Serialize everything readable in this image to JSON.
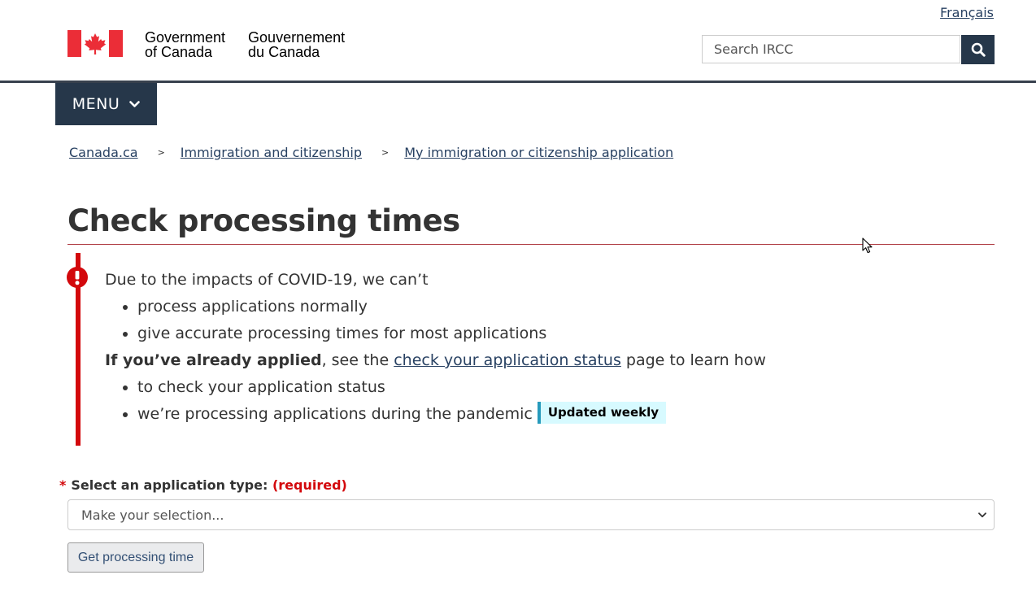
{
  "header": {
    "language_link": "Français",
    "signature_en": [
      "Government",
      "of Canada"
    ],
    "signature_fr": [
      "Gouvernement",
      "du Canada"
    ],
    "search_placeholder": "Search IRCC",
    "search_icon": "search-icon",
    "menu_label": "MENU",
    "menu_icon": "chevron-down-icon"
  },
  "breadcrumb": [
    "Canada.ca",
    "Immigration and citizenship",
    "My immigration or citizenship application"
  ],
  "breadcrumb_separator": ">",
  "page": {
    "title": "Check processing times"
  },
  "alert": {
    "icon": "exclamation-icon",
    "intro": "Due to the impacts of COVID-19, we can’t",
    "bullets_1": [
      "process applications normally",
      "give accurate processing times for most applications"
    ],
    "applied_bold": "If you’ve already applied",
    "applied_mid": ", see the ",
    "applied_link": "check your application status",
    "applied_end": " page to learn how",
    "bullets_2": [
      "to check your application status",
      "we’re processing applications during the pandemic"
    ],
    "badge": "Updated weekly"
  },
  "form": {
    "required_marker": "*",
    "label": "Select an application type:",
    "required_text": "(required)",
    "select_value": "Make your selection...",
    "submit_label": "Get processing time"
  },
  "colors": {
    "brand_dark": "#26374a",
    "link": "#284162",
    "alert_red": "#d3080c",
    "badge_bg": "#d7faff",
    "badge_border": "#269abc"
  }
}
